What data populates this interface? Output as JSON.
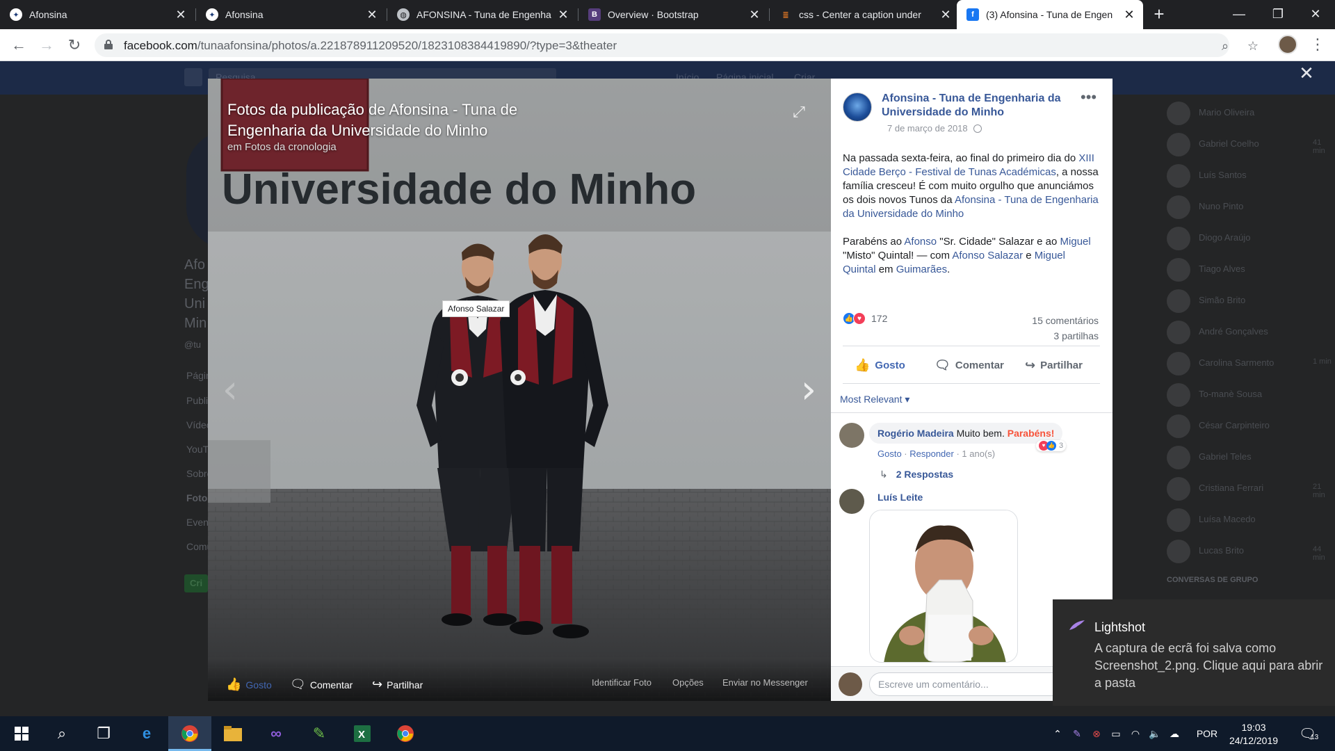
{
  "browser": {
    "tabs": [
      {
        "title": "Afonsina",
        "icon": "tuna-crest-icon",
        "active": false
      },
      {
        "title": "Afonsina",
        "icon": "tuna-crest-icon",
        "active": false
      },
      {
        "title": "AFONSINA - Tuna de Engenha",
        "icon": "globe-icon",
        "active": false
      },
      {
        "title": "Overview · Bootstrap",
        "icon": "bootstrap-icon",
        "active": false
      },
      {
        "title": "css - Center a caption under",
        "icon": "stackoverflow-icon",
        "active": false
      },
      {
        "title": "(3) Afonsina - Tuna de Engen",
        "icon": "facebook-icon",
        "active": true
      }
    ],
    "url_host": "facebook.com",
    "url_path": "/tunaafonsina/photos/a.221878911209520/1823108384419890/?type=3&theater"
  },
  "viewer": {
    "title": "Fotos da publicação de Afonsina - Tuna de Engenharia da Universidade do Minho",
    "subtitle": "em Fotos da cronologia",
    "sign_text": "Universidade do Minho",
    "tag": "Afonso Salazar",
    "actions": {
      "like": "Gosto",
      "comment": "Comentar",
      "share": "Partilhar",
      "tag_photo": "Identificar Foto",
      "options": "Opções",
      "messenger": "Enviar no Messenger"
    }
  },
  "post": {
    "page_name": "Afonsina - Tuna de Engenharia da Universidade do Minho",
    "date": "7 de março de 2018",
    "para1_a": "Na passada sexta-feira, ao final do primeiro dia do ",
    "para1_link1": "XIII Cidade Berço - Festival de Tunas Académicas",
    "para1_b": ", a nossa família cresceu! É com muito orgulho que anunciámos os dois novos Tunos da ",
    "para1_link2": "Afonsina - Tuna de Engenharia da Universidade do Minho",
    "para2_a": "Parabéns ao ",
    "para2_link1": "Afonso",
    "para2_b": " \"Sr. Cidade\" Salazar e ao ",
    "para2_link2": "Miguel",
    "para2_c": " \"Misto\" Quintal! — com ",
    "para2_link3": "Afonso Salazar",
    "para2_d": " e ",
    "para2_link4": "Miguel Quintal",
    "para2_e": " em ",
    "para2_link5": "Guimarães",
    "para2_f": ".",
    "reactions_count": "172",
    "comments_count": "15 comentários",
    "shares_count": "3 partilhas",
    "like_label": "Gosto",
    "comment_label": "Comentar",
    "share_label": "Partilhar",
    "sort_label": "Most Relevant",
    "comments": [
      {
        "author": "Rogério Madeira",
        "text": "Muito bem.",
        "highlight": "Parabéns!",
        "like": "Gosto",
        "reply": "Responder",
        "age": "1 ano(s)",
        "reactions": "3",
        "replies": "2 Respostas"
      },
      {
        "author": "Luís Leite"
      }
    ],
    "composer_placeholder": "Escreve um comentário..."
  },
  "background": {
    "search": "Pesquisa",
    "nav": [
      "Início",
      "Página inicial",
      "Criar"
    ],
    "side": [
      "Páginas",
      "Publicações",
      "Vídeos",
      "YouTube",
      "Sobre",
      "Fotos",
      "Eventos",
      "Comunidade"
    ],
    "page_name_lines": [
      "Afo",
      "Eng",
      "Uni",
      "Min"
    ],
    "handle": "@tu",
    "create_btn": "Cri",
    "contacts": [
      {
        "name": "Mario Oliveira",
        "time": ""
      },
      {
        "name": "Gabriel Coelho",
        "time": "41 min"
      },
      {
        "name": "Luís Santos",
        "time": ""
      },
      {
        "name": "Nuno Pinto",
        "time": ""
      },
      {
        "name": "Diogo Araújo",
        "time": ""
      },
      {
        "name": "Tiago Alves",
        "time": ""
      },
      {
        "name": "Simão Brito",
        "time": ""
      },
      {
        "name": "André Gonçalves",
        "time": ""
      },
      {
        "name": "Carolina Sarmento",
        "time": "1 min"
      },
      {
        "name": "To-manè Sousa",
        "time": ""
      },
      {
        "name": "César Carpinteiro",
        "time": ""
      },
      {
        "name": "Gabriel Teles",
        "time": ""
      },
      {
        "name": "Cristiana Ferrari",
        "time": "21 min"
      },
      {
        "name": "Luísa Macedo",
        "time": ""
      },
      {
        "name": "Lucas Brito",
        "time": "44 min"
      }
    ],
    "group_header": "CONVERSAS DE GRUPO"
  },
  "toast": {
    "app": "Lightshot",
    "message": "A captura de ecrã foi salva como Screenshot_2.png. Clique aqui para abrir a pasta"
  },
  "taskbar": {
    "language": "POR",
    "time": "19:03",
    "date": "24/12/2019",
    "notifications": "13"
  }
}
